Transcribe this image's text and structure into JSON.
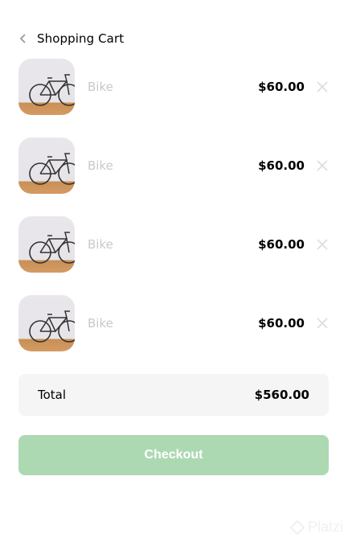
{
  "header": {
    "title": "Shopping Cart",
    "back_icon": "chevron-left-icon"
  },
  "cart": {
    "items": [
      {
        "name": "Bike",
        "price": "$60.00",
        "image": "bicycle-photo",
        "remove_icon": "close-icon"
      },
      {
        "name": "Bike",
        "price": "$60.00",
        "image": "bicycle-photo",
        "remove_icon": "close-icon"
      },
      {
        "name": "Bike",
        "price": "$60.00",
        "image": "bicycle-photo",
        "remove_icon": "close-icon"
      },
      {
        "name": "Bike",
        "price": "$60.00",
        "image": "bicycle-photo",
        "remove_icon": "close-icon"
      }
    ]
  },
  "summary": {
    "total_label": "Total",
    "total_value": "$560.00"
  },
  "checkout": {
    "label": "Checkout"
  },
  "watermark": {
    "text": "Platzi"
  },
  "colors": {
    "accent": "#acd9b2",
    "muted_text": "#c9c9c9",
    "summary_bg": "#f5f5f5"
  }
}
